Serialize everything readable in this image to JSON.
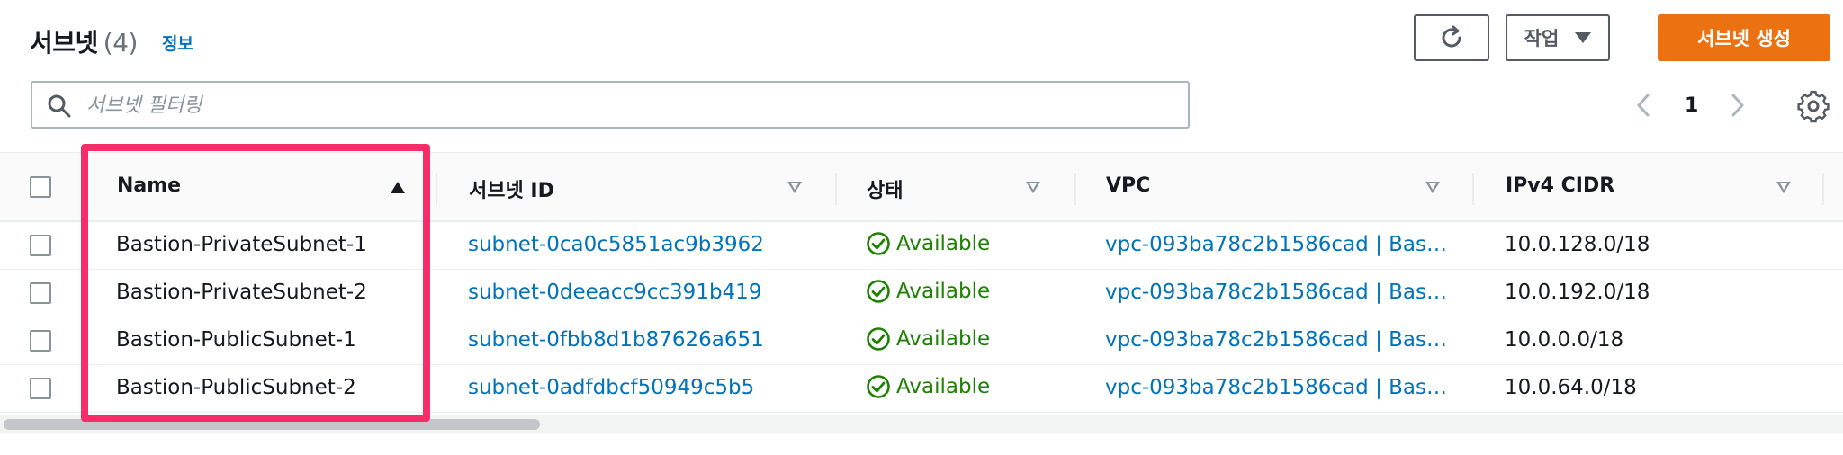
{
  "header": {
    "title": "서브넷",
    "count": "(4)",
    "info_link": "정보",
    "actions_label": "작업",
    "create_label": "서브넷 생성"
  },
  "filter": {
    "placeholder": "서브넷 필터링",
    "value": ""
  },
  "pagination": {
    "current_page": "1"
  },
  "table": {
    "columns": [
      "Name",
      "서브넷 ID",
      "상태",
      "VPC",
      "IPv4 CIDR"
    ],
    "sorted_column": "Name",
    "sort_direction": "ascending",
    "rows": [
      {
        "name": "Bastion-PrivateSubnet-1",
        "subnet_id": "subnet-0ca0c5851ac9b3962",
        "status": "Available",
        "vpc": "vpc-093ba78c2b1586cad | Bas…",
        "cidr": "10.0.128.0/18"
      },
      {
        "name": "Bastion-PrivateSubnet-2",
        "subnet_id": "subnet-0deeacc9cc391b419",
        "status": "Available",
        "vpc": "vpc-093ba78c2b1586cad | Bas…",
        "cidr": "10.0.192.0/18"
      },
      {
        "name": "Bastion-PublicSubnet-1",
        "subnet_id": "subnet-0fbb8d1b87626a651",
        "status": "Available",
        "vpc": "vpc-093ba78c2b1586cad | Bas…",
        "cidr": "10.0.0.0/18"
      },
      {
        "name": "Bastion-PublicSubnet-2",
        "subnet_id": "subnet-0adfdbcf50949c5b5",
        "status": "Available",
        "vpc": "vpc-093ba78c2b1586cad | Bas…",
        "cidr": "10.0.64.0/18"
      }
    ]
  },
  "icons": {
    "refresh": "refresh-icon",
    "search": "search-icon",
    "prev": "chevron-left-icon",
    "next": "chevron-right-icon",
    "settings": "gear-icon",
    "status": "check-circle-icon"
  },
  "colors": {
    "primary_button": "#ec7211",
    "link": "#0073bb",
    "status_available": "#1d8102",
    "highlight": "#f72d6a"
  }
}
